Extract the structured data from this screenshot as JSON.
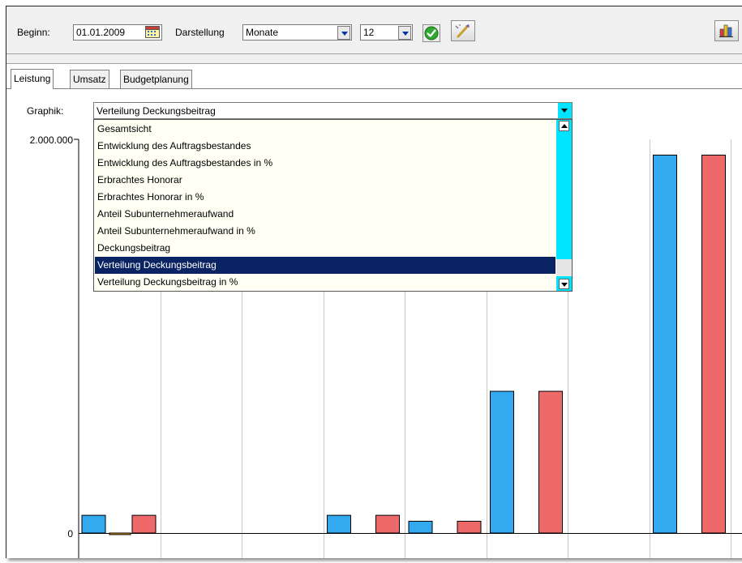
{
  "toolbar": {
    "beginn_label": "Beginn:",
    "beginn_value": "01.01.2009",
    "darstellung_label": "Darstellung",
    "darstellung_value": "Monate",
    "count_value": "12"
  },
  "tabs": [
    {
      "label": "Leistung",
      "active": true
    },
    {
      "label": "Umsatz",
      "active": false
    },
    {
      "label": "Budgetplanung",
      "active": false
    }
  ],
  "graphik": {
    "label": "Graphik:",
    "selected": "Verteilung Deckungsbeitrag",
    "options": [
      "Gesamtsicht",
      "Entwicklung des Auftragsbestandes",
      "Entwicklung des Auftragsbestandes in %",
      "Erbrachtes Honorar",
      "Erbrachtes Honorar in %",
      "Anteil Subunternehmeraufwand",
      "Anteil Subunternehmeraufwand in %",
      "Deckungsbeitrag",
      "Verteilung Deckungsbeitrag",
      "Verteilung Deckungsbeitrag in %"
    ],
    "selected_index": 8
  },
  "colors": {
    "series_a": "#33aaf0",
    "series_b": "#ee6a6a",
    "series_c": "#e0a020",
    "selection": "#0a2463",
    "scroll": "#00e5ff"
  },
  "chart_data": {
    "type": "bar",
    "ylim": [
      0,
      2000000
    ],
    "y_tick_labels": [
      "0",
      "2.000.000"
    ],
    "groups": [
      {
        "values": [
          {
            "series": "a",
            "value": 90000
          },
          {
            "series": "c",
            "value": -8000
          },
          {
            "series": "b",
            "value": 90000
          }
        ]
      },
      {
        "values": []
      },
      {
        "values": []
      },
      {
        "values": [
          {
            "series": "a",
            "value": 90000
          },
          {
            "series": "b",
            "value": 90000
          }
        ]
      },
      {
        "values": [
          {
            "series": "a",
            "value": 60000
          },
          {
            "series": "b",
            "value": 60000
          }
        ]
      },
      {
        "values": [
          {
            "series": "a",
            "value": 720000
          },
          {
            "series": "b",
            "value": 720000
          }
        ]
      },
      {
        "values": []
      },
      {
        "values": [
          {
            "series": "a",
            "value": 1920000
          },
          {
            "series": "b",
            "value": 1920000
          }
        ]
      }
    ]
  }
}
